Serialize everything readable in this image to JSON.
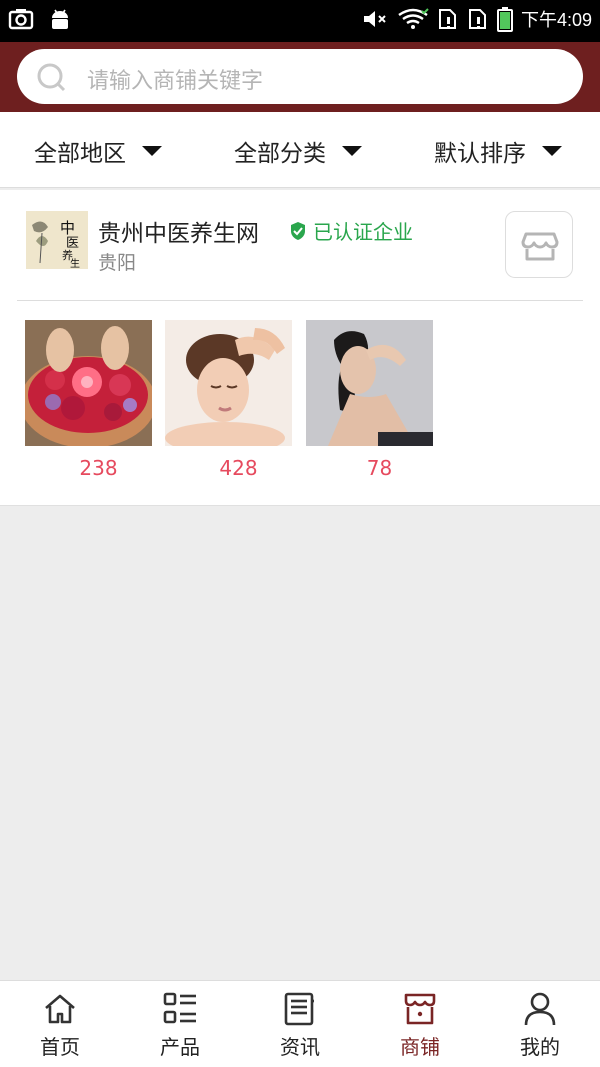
{
  "status_bar": {
    "time": "下午4:09"
  },
  "search": {
    "placeholder": "请输入商铺关键字"
  },
  "filters": [
    {
      "label": "全部地区"
    },
    {
      "label": "全部分类"
    },
    {
      "label": "默认排序"
    }
  ],
  "store": {
    "name": "贵州中医养生网",
    "verified_label": "已认证企业",
    "city": "贵阳",
    "products": [
      {
        "count": "238"
      },
      {
        "count": "428"
      },
      {
        "count": "78"
      }
    ]
  },
  "nav": {
    "items": [
      {
        "label": "首页",
        "icon": "home-icon"
      },
      {
        "label": "产品",
        "icon": "product-list-icon"
      },
      {
        "label": "资讯",
        "icon": "news-icon"
      },
      {
        "label": "商铺",
        "icon": "store-icon",
        "active": true
      },
      {
        "label": "我的",
        "icon": "user-icon"
      }
    ],
    "active_color": "#7a2525"
  },
  "colors": {
    "header": "#6e1f1f",
    "verified": "#2aa64d",
    "count": "#e64a5e"
  }
}
